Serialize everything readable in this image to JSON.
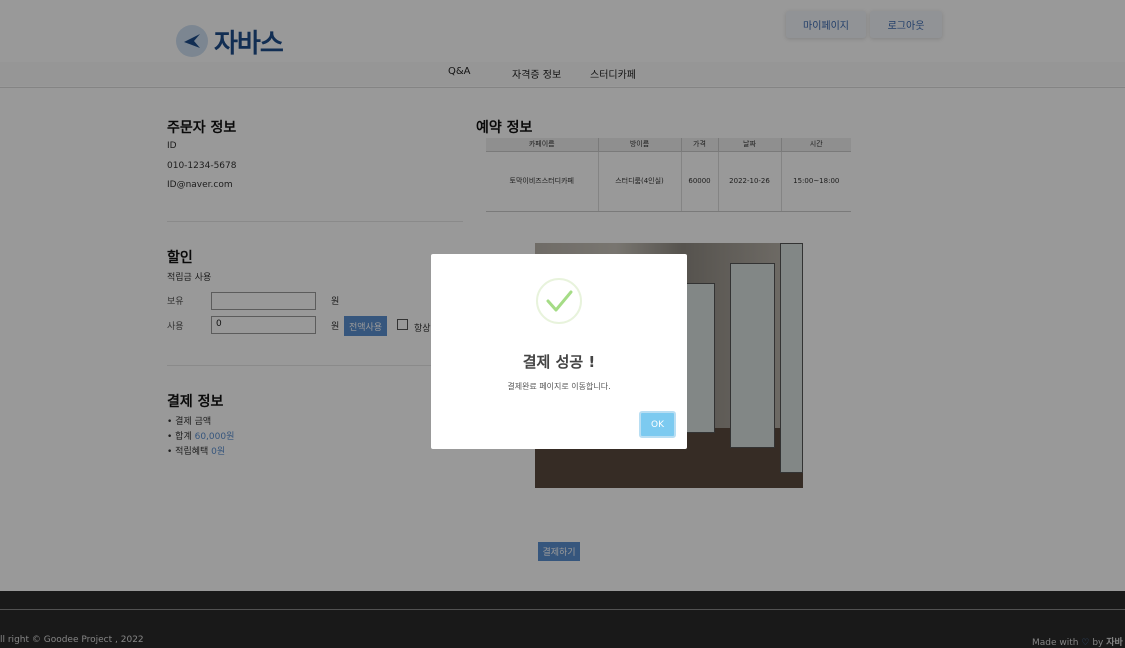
{
  "brand": {
    "logo_text": "자바스"
  },
  "header": {
    "mypage_label": "마이페이지",
    "logout_label": "로그아웃"
  },
  "nav": {
    "items": [
      "Q&A",
      "자격증 정보",
      "스터디카페"
    ]
  },
  "orderer": {
    "title": "주문자 정보",
    "id": "ID",
    "phone": "010-1234-5678",
    "email": "ID@naver.com"
  },
  "reservation": {
    "title": "예약 정보",
    "columns": [
      "카페이름",
      "방이름",
      "가격",
      "날짜",
      "시간"
    ],
    "row": [
      "토막이비즈스터디카페",
      "스터디룸(4인실)",
      "60000",
      "2022-10-26",
      "15:00~18:00"
    ]
  },
  "discount": {
    "title": "할인",
    "subtitle": "적립금 사용",
    "held_label": "보유",
    "held_value": "",
    "use_label": "사용",
    "use_value": "0",
    "won": "원",
    "use_all_label": "전액사용",
    "always_label": "항상"
  },
  "payment": {
    "title": "결제 정보",
    "amount_label": "결제 금액",
    "total_label": "합계",
    "total_value": "60,000원",
    "reward_label": "적립혜택",
    "reward_value": "0원",
    "pay_button": "결제하기"
  },
  "footer": {
    "copyright": "ll right © Goodee Project , 2022",
    "made_with": "Made with",
    "by": "by",
    "brand": "자바스"
  },
  "modal": {
    "title": "결제 성공 !",
    "message": "결제완료 페이지로 이동합니다.",
    "ok_label": "OK"
  },
  "colors": {
    "accent": "#5b8fd0",
    "ok": "#7ccaf0",
    "check": "#a5dc86"
  }
}
